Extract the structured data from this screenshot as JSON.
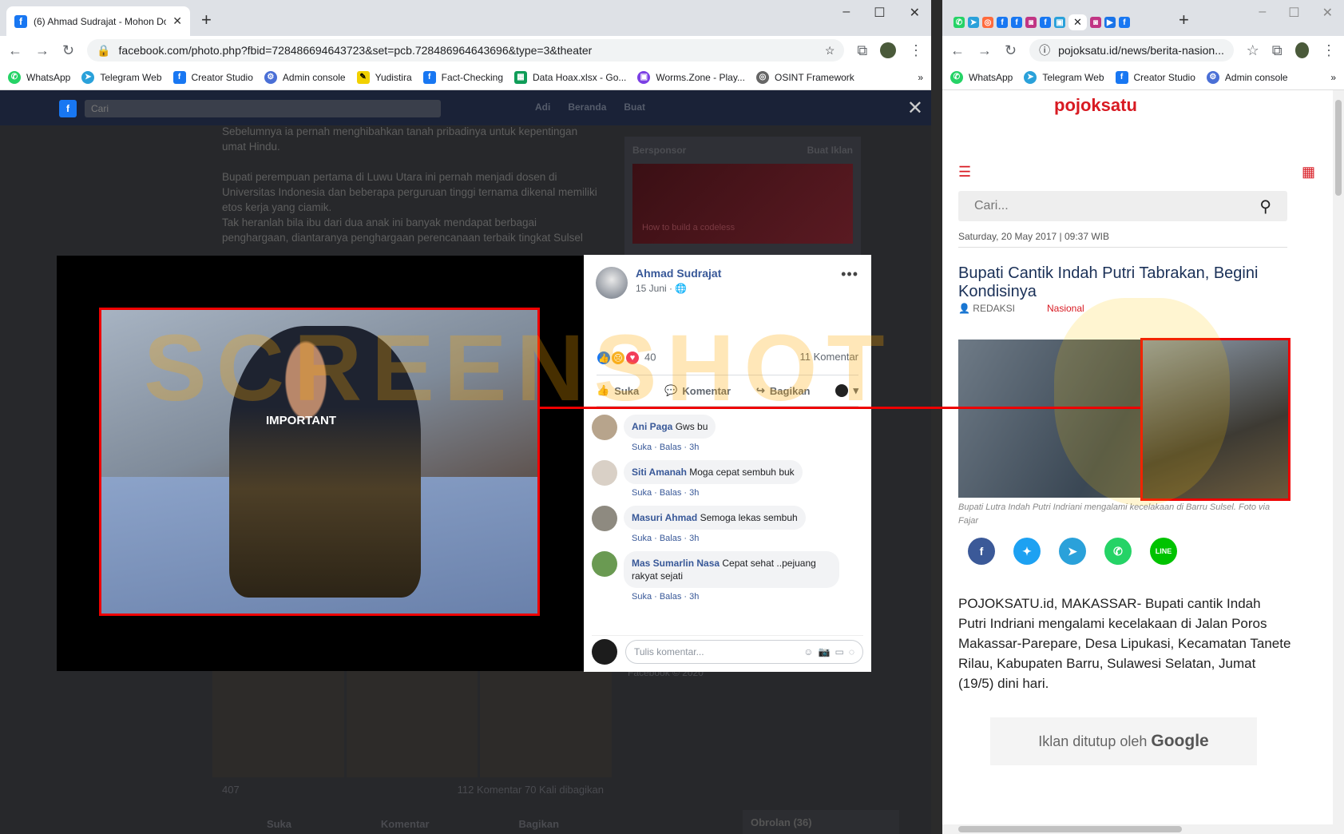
{
  "left": {
    "tab_title": "(6) Ahmad Sudrajat - Mohon Do",
    "url": "facebook.com/photo.php?fbid=728486694643723&set=pcb.728486964643696&type=3&theater",
    "bookmarks": [
      "WhatsApp",
      "Telegram Web",
      "Creator Studio",
      "Admin console",
      "Yudistira",
      "Fact-Checking",
      "Data Hoax.xlsx - Go...",
      "Worms.Zone - Play...",
      "OSINT Framework"
    ],
    "fb": {
      "search_placeholder": "Cari",
      "nav": [
        "Adi",
        "Beranda",
        "Buat"
      ],
      "bg_text": "Sebelumnya ia pernah menghibahkan tanah pribadinya untuk kepentingan umat Hindu.\n\nBupati perempuan pertama di Luwu Utara ini pernah menjadi dosen di Universitas Indonesia dan beberapa perguruan tinggi ternama dikenal memiliki etos kerja yang ciamik.\nTak heranlah bila ibu dari dua anak ini banyak mendapat berbagai penghargaan, diantaranya penghargaan perencanaan terbaik tingkat Sulsel",
      "sponsored": "Bersponsor",
      "create_ad": "Buat Iklan",
      "ad_text": "How to build a codeless",
      "bg_reacts": "407",
      "bg_counts": "112 Komentar  70 Kali dibagikan",
      "bg_actions": [
        "Suka",
        "Komentar",
        "Bagikan"
      ],
      "footer_text": "Facebook © 2020",
      "chat_label": "Obrolan (36)"
    },
    "post": {
      "author": "Ahmad Sudrajat",
      "date": "15 Juni",
      "reaction_count": "40",
      "comment_count": "11 Komentar",
      "actions": [
        "Suka",
        "Komentar",
        "Bagikan"
      ],
      "comments": [
        {
          "name": "Ani Paga",
          "text": "Gws bu",
          "meta": "Suka · Balas · 3h"
        },
        {
          "name": "Siti Amanah",
          "text": "Moga cepat sembuh buk",
          "meta": "Suka · Balas · 3h"
        },
        {
          "name": "Masuri Ahmad",
          "text": "Semoga lekas sembuh",
          "meta": "Suka · Balas · 3h"
        },
        {
          "name": "Mas Sumarlin Nasa",
          "text": "Cepat sehat ..pejuang rakyat sejati",
          "meta": "Suka · Balas · 3h"
        }
      ],
      "composer_placeholder": "Tulis komentar..."
    },
    "photo_text": "IMPORTANT",
    "watermark": "SCREENSHOT BY"
  },
  "right": {
    "url": "pojoksatu.id/news/berita-nasion...",
    "bookmarks": [
      "WhatsApp",
      "Telegram Web",
      "Creator Studio",
      "Admin console"
    ],
    "logo": "pojoksatu",
    "search_placeholder": "Cari...",
    "date": "Saturday, 20 May 2017 | 09:37 WIB",
    "title": "Bupati Cantik Indah Putri Tabrakan, Begini Kondisinya",
    "author": "REDAKSI",
    "category": "Nasional",
    "caption": "Bupati Lutra Indah Putri Indriani mengalami kecelakaan di Barru Sulsel. Foto via Fajar",
    "body": "POJOKSATU.id, MAKASSAR- Bupati cantik Indah Putri Indriani mengalami kecelakaan di Jalan Poros Makassar-Parepare, Desa Lipukasi, Kecamatan Tanete Rilau, Kabupaten Barru, Sulawesi Selatan, Jumat (19/5) dini hari.",
    "ad_closed": "Iklan ditutup oleh",
    "ad_brand": "Google"
  }
}
